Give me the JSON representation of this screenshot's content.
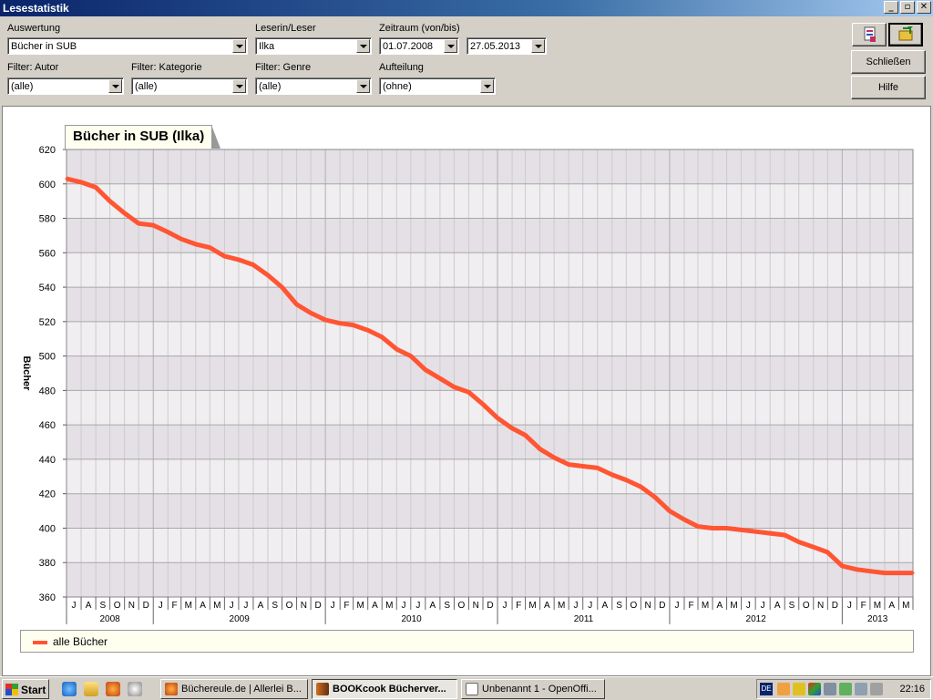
{
  "window": {
    "title": "Lesestatistik",
    "controls": [
      "_",
      "▫",
      "✕"
    ]
  },
  "toolbar": {
    "auswertung": {
      "label": "Auswertung",
      "value": "Bücher in SUB"
    },
    "leser": {
      "label": "Leserin/Leser",
      "value": "Ilka"
    },
    "zeitraum": {
      "label": "Zeitraum (von/bis)",
      "from": "01.07.2008",
      "to": "27.05.2013"
    },
    "filter_autor": {
      "label": "Filter: Autor",
      "value": "(alle)"
    },
    "filter_kategorie": {
      "label": "Filter: Kategorie",
      "value": "(alle)"
    },
    "filter_genre": {
      "label": "Filter: Genre",
      "value": "(alle)"
    },
    "aufteilung": {
      "label": "Aufteilung",
      "value": "(ohne)"
    },
    "schliessen_label": "Schließen",
    "hilfe_label": "Hilfe",
    "icon_report": "report-icon",
    "icon_export": "export-icon"
  },
  "chart_data": {
    "type": "line",
    "title": "Bücher in SUB (Ilka)",
    "xlabel": "",
    "ylabel": "Bücher",
    "ylim": [
      360,
      620
    ],
    "yticks": [
      360,
      380,
      400,
      420,
      440,
      460,
      480,
      500,
      520,
      540,
      560,
      580,
      600,
      620
    ],
    "xlim": [
      "2008-07-01",
      "2013-05-31"
    ],
    "month_letters": [
      "J",
      "A",
      "S",
      "O",
      "N",
      "D",
      "J",
      "F",
      "M",
      "A",
      "M",
      "J",
      "J",
      "A",
      "S",
      "O",
      "N",
      "D",
      "J",
      "F",
      "M",
      "A",
      "M",
      "J",
      "J",
      "A",
      "S",
      "O",
      "N",
      "D",
      "J",
      "F",
      "M",
      "A",
      "M",
      "J",
      "J",
      "A",
      "S",
      "O",
      "N",
      "D",
      "J",
      "F",
      "M",
      "A",
      "M",
      "J",
      "J",
      "A",
      "S",
      "O",
      "N",
      "D",
      "J",
      "F",
      "M",
      "A",
      "M"
    ],
    "year_labels": [
      {
        "label": "2008",
        "month_start": 0,
        "month_end": 6
      },
      {
        "label": "2009",
        "month_start": 6,
        "month_end": 18
      },
      {
        "label": "2010",
        "month_start": 18,
        "month_end": 30
      },
      {
        "label": "2011",
        "month_start": 30,
        "month_end": 42
      },
      {
        "label": "2012",
        "month_start": 42,
        "month_end": 54
      },
      {
        "label": "2013",
        "month_start": 54,
        "month_end": 59
      }
    ],
    "color": "#ff5533",
    "series": [
      {
        "name": "alle Bücher",
        "points": [
          [
            "2008-07-01",
            603
          ],
          [
            "2008-08-01",
            601
          ],
          [
            "2008-09-01",
            598
          ],
          [
            "2008-10-01",
            590
          ],
          [
            "2008-11-01",
            583
          ],
          [
            "2008-12-01",
            577
          ],
          [
            "2009-01-01",
            576
          ],
          [
            "2009-02-01",
            572
          ],
          [
            "2009-03-01",
            568
          ],
          [
            "2009-04-01",
            565
          ],
          [
            "2009-05-01",
            563
          ],
          [
            "2009-06-01",
            558
          ],
          [
            "2009-07-01",
            556
          ],
          [
            "2009-08-01",
            553
          ],
          [
            "2009-09-01",
            547
          ],
          [
            "2009-10-01",
            540
          ],
          [
            "2009-11-01",
            530
          ],
          [
            "2009-12-01",
            525
          ],
          [
            "2010-01-01",
            521
          ],
          [
            "2010-02-01",
            519
          ],
          [
            "2010-03-01",
            518
          ],
          [
            "2010-04-01",
            515
          ],
          [
            "2010-05-01",
            511
          ],
          [
            "2010-06-01",
            504
          ],
          [
            "2010-07-01",
            500
          ],
          [
            "2010-08-01",
            492
          ],
          [
            "2010-09-01",
            487
          ],
          [
            "2010-10-01",
            482
          ],
          [
            "2010-11-01",
            479
          ],
          [
            "2010-12-01",
            472
          ],
          [
            "2011-01-01",
            464
          ],
          [
            "2011-02-01",
            458
          ],
          [
            "2011-03-01",
            454
          ],
          [
            "2011-04-01",
            446
          ],
          [
            "2011-05-01",
            441
          ],
          [
            "2011-06-01",
            437
          ],
          [
            "2011-07-01",
            436
          ],
          [
            "2011-08-01",
            435
          ],
          [
            "2011-09-01",
            431
          ],
          [
            "2011-10-01",
            428
          ],
          [
            "2011-11-01",
            424
          ],
          [
            "2011-12-01",
            418
          ],
          [
            "2012-01-01",
            410
          ],
          [
            "2012-02-01",
            405
          ],
          [
            "2012-03-01",
            401
          ],
          [
            "2012-04-01",
            400
          ],
          [
            "2012-05-01",
            400
          ],
          [
            "2012-06-01",
            399
          ],
          [
            "2012-07-01",
            398
          ],
          [
            "2012-08-01",
            397
          ],
          [
            "2012-09-01",
            396
          ],
          [
            "2012-10-01",
            392
          ],
          [
            "2012-11-01",
            389
          ],
          [
            "2012-12-01",
            386
          ],
          [
            "2013-01-01",
            378
          ],
          [
            "2013-02-01",
            376
          ],
          [
            "2013-03-01",
            375
          ],
          [
            "2013-04-01",
            374
          ],
          [
            "2013-05-01",
            374
          ],
          [
            "2013-05-31",
            374
          ]
        ]
      }
    ],
    "legend": {
      "position": "bottom",
      "entries": [
        "alle Bücher"
      ]
    },
    "grid": true
  },
  "taskbar": {
    "start_label": "Start",
    "quicklaunch": [
      "ie-icon",
      "folder-icon",
      "firefox-icon",
      "search-icon"
    ],
    "tasks": [
      {
        "label": "Büchereule.de | Allerlei B...",
        "icon": "firefox-icon",
        "active": false
      },
      {
        "label": "BOOKcook Bücherver...",
        "icon": "bookcook-icon",
        "active": true
      },
      {
        "label": "Unbenannt 1 - OpenOffi...",
        "icon": "openoffice-icon",
        "active": false
      }
    ],
    "tray_lang": "DE",
    "clock": "22:16"
  }
}
